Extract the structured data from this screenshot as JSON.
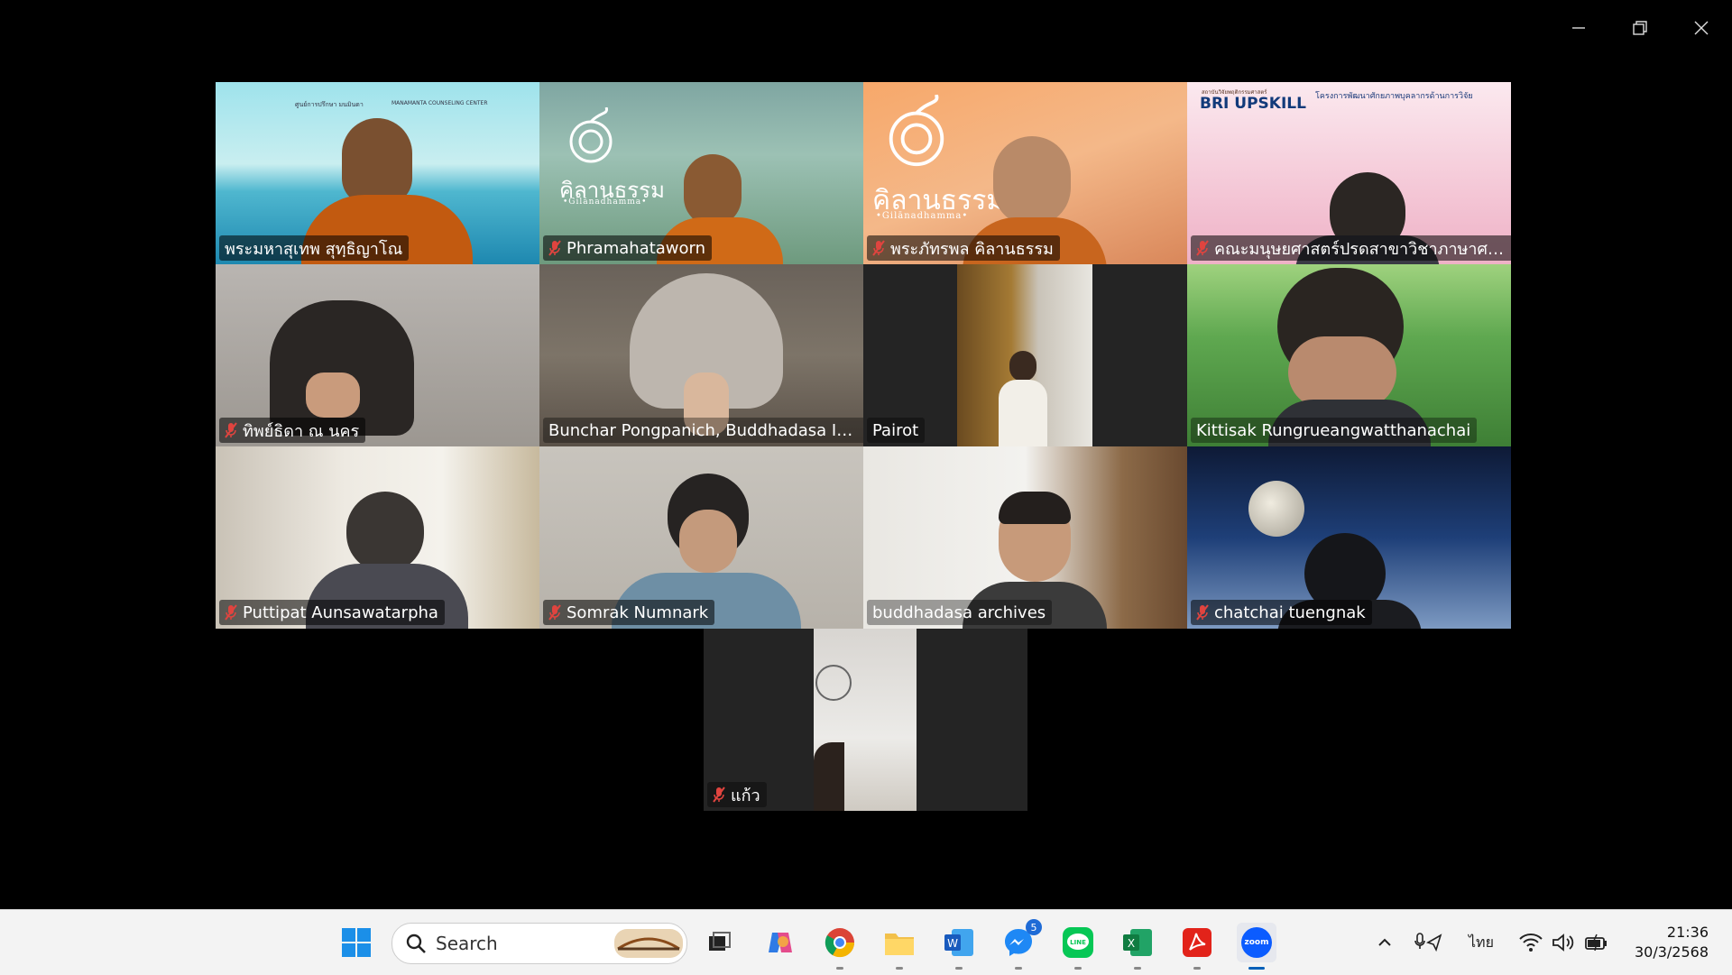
{
  "participants": [
    {
      "name": "พระมหาสุเทพ สุทฺธิญาโณ",
      "muted": false
    },
    {
      "name": "Phramahataworn",
      "muted": true
    },
    {
      "name": "พระภัทรพล คิลานธรรม",
      "muted": true
    },
    {
      "name": "คณะมนุษยศาสตร์ปรดสาขาวิชาภาษาศาสตร์",
      "muted": true
    },
    {
      "name": "ทิพย์ธิดา ณ นคร",
      "muted": true
    },
    {
      "name": "Bunchar Pongpanich, Buddhadasa Indh...",
      "muted": false
    },
    {
      "name": "Pairot",
      "muted": false
    },
    {
      "name": "Kittisak Rungrueangwatthanachai",
      "muted": false
    },
    {
      "name": "Puttipat Aunsawatarpha",
      "muted": true
    },
    {
      "name": "Somrak Numnark",
      "muted": true
    },
    {
      "name": "buddhadasa archives",
      "muted": false
    },
    {
      "name": "chatchai tuengnak",
      "muted": true
    },
    {
      "name": "แก้ว",
      "muted": true
    }
  ],
  "backgrounds": {
    "tile1_header": "ศูนย์การปรึกษา มนมินดา",
    "tile1_center": "MANAMANTA COUNSELING CENTER",
    "logo_main": "คิลานธรรม",
    "logo_sub": "•Gilānadhamma•",
    "tile4_org": "สถาบันวิจัยพฤติกรรมศาสตร์",
    "tile4_brand": "BRI UPSKILL",
    "tile4_title": "โครงการพัฒนาศักยภาพบุคลากรด้านการวิจัย"
  },
  "taskbar": {
    "search_placeholder": "Search",
    "messenger_badge": "5",
    "language": "ไทย",
    "time": "21:36",
    "date": "30/3/2568",
    "apps": [
      "start-icon",
      "search",
      "task-view-icon",
      "copilot-icon",
      "chrome-icon",
      "file-explorer-icon",
      "word-icon",
      "messenger-icon",
      "line-icon",
      "excel-icon",
      "acrobat-icon",
      "zoom-icon"
    ],
    "zoom_label": "zoom"
  },
  "colors": {
    "active_speaker": "#39d98a",
    "muted_mic": "#e0443f",
    "taskbar_bg": "#f3f3f3"
  }
}
